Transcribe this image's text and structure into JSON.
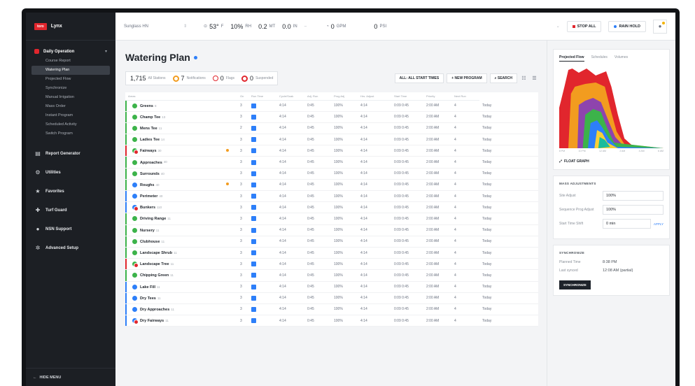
{
  "app": {
    "logo": "toro",
    "name": "Lynx"
  },
  "sidebar": {
    "group": {
      "label": "Daily Operation",
      "items": [
        {
          "label": "Course Report"
        },
        {
          "label": "Watering Plan",
          "active": true
        },
        {
          "label": "Projected Flow"
        },
        {
          "label": "Synchronize"
        },
        {
          "label": "Manual Irrigation"
        },
        {
          "label": "Mass Order"
        },
        {
          "label": "Instant Program"
        },
        {
          "label": "Scheduled Activity"
        },
        {
          "label": "Switch Program"
        }
      ]
    },
    "sections": [
      {
        "label": "Report Generator",
        "icon": "document-icon"
      },
      {
        "label": "Utilities",
        "icon": "utilities-icon"
      },
      {
        "label": "Favorites",
        "icon": "star-icon"
      },
      {
        "label": "Turf Guard",
        "icon": "sensor-icon"
      },
      {
        "label": "NSN Support",
        "icon": "support-icon"
      },
      {
        "label": "Advanced Setup",
        "icon": "gear-icon"
      }
    ],
    "hide_menu": "HIDE MENU"
  },
  "topbar": {
    "location": "Sunglass HN",
    "temp": "53°",
    "temp_unit": "F",
    "humidity": "10%",
    "humidity_unit": "RH",
    "wind": "0.2",
    "wind_unit": "MT",
    "rain": "0.0",
    "rain_unit": "IN",
    "flow": "0",
    "flow_unit": "GPM",
    "pressure": "0",
    "pressure_unit": "PSI",
    "stop_all": "STOP ALL",
    "rain_hold": "RAIN HOLD"
  },
  "plan": {
    "title": "Watering Plan",
    "stats": {
      "holes": "1,715",
      "holes_label": "All Stations",
      "notifications": "7",
      "notifications_label": "Notifications",
      "flags": "0",
      "flags_label": "Flags",
      "suspended": "0",
      "suspended_label": "Suspended"
    },
    "actions": {
      "all_start": "ALL: ALL START TIMES",
      "new_program": "+ NEW PROGRAM",
      "search": "SEARCH"
    },
    "columns": [
      "Areas",
      "",
      "On",
      "Run Time",
      "Cycle/Soak",
      "Adj. Run",
      "Prog Adj",
      "Hrs. Adjust",
      "Start Time",
      "Priority",
      "Next Run"
    ],
    "rows": [
      {
        "name": "Greens",
        "sub": "8",
        "icon": "g",
        "bar": "#3cb34a",
        "warn": false,
        "n": "3",
        "v1": "4:14",
        "v2": "0:45",
        "v3": "100%",
        "v4": "4:14",
        "v5": "0:09 0:45",
        "v6": "2:00 AM",
        "v7": "4",
        "v8": "Today"
      },
      {
        "name": "Champ Tee",
        "sub": "13",
        "icon": "g",
        "bar": "#3cb34a",
        "warn": false,
        "n": "3",
        "v1": "4:14",
        "v2": "0:45",
        "v3": "100%",
        "v4": "4:14",
        "v5": "0:09 0:45",
        "v6": "2:00 AM",
        "v7": "4",
        "v8": "Today"
      },
      {
        "name": "Mens Tee",
        "sub": "11",
        "icon": "g",
        "bar": "#3cb34a",
        "warn": false,
        "n": "2",
        "v1": "4:14",
        "v2": "0:45",
        "v3": "100%",
        "v4": "4:14",
        "v5": "0:09 0:45",
        "v6": "2:00 AM",
        "v7": "4",
        "v8": "Today"
      },
      {
        "name": "Ladies Tee",
        "sub": "14",
        "icon": "g",
        "bar": "#3cb34a",
        "warn": false,
        "n": "3",
        "v1": "4:14",
        "v2": "0:45",
        "v3": "100%",
        "v4": "4:14",
        "v5": "0:09 0:45",
        "v6": "2:00 AM",
        "v7": "4",
        "v8": "Today"
      },
      {
        "name": "Fairways",
        "sub": "30",
        "icon": "mix",
        "bar": "#e1262d",
        "warn": true,
        "n": "3",
        "v1": "4:14",
        "v2": "0:45",
        "v3": "100%",
        "v4": "4:14",
        "v5": "0:09 0:45",
        "v6": "2:00 AM",
        "v7": "4",
        "v8": "Today"
      },
      {
        "name": "Approaches",
        "sub": "40",
        "icon": "g",
        "bar": "#3cb34a",
        "warn": false,
        "n": "3",
        "v1": "4:14",
        "v2": "0:45",
        "v3": "100%",
        "v4": "4:14",
        "v5": "0:09 0:45",
        "v6": "2:00 AM",
        "v7": "4",
        "v8": "Today"
      },
      {
        "name": "Surrounds",
        "sub": "40",
        "icon": "g",
        "bar": "#3cb34a",
        "warn": false,
        "n": "3",
        "v1": "4:14",
        "v2": "0:45",
        "v3": "100%",
        "v4": "4:14",
        "v5": "0:09 0:45",
        "v6": "2:00 AM",
        "v7": "4",
        "v8": "Today"
      },
      {
        "name": "Roughs",
        "sub": "40",
        "icon": "b",
        "bar": "#3cb34a",
        "warn": true,
        "n": "3",
        "v1": "4:14",
        "v2": "0:45",
        "v3": "100%",
        "v4": "4:14",
        "v5": "0:09 0:45",
        "v6": "2:00 AM",
        "v7": "4",
        "v8": "Today"
      },
      {
        "name": "Perimeter",
        "sub": "40",
        "icon": "b",
        "bar": "#2d7ff9",
        "warn": false,
        "n": "3",
        "v1": "4:14",
        "v2": "0:45",
        "v3": "100%",
        "v4": "4:14",
        "v5": "0:09 0:45",
        "v6": "2:00 AM",
        "v7": "4",
        "v8": "Today"
      },
      {
        "name": "Bunkers",
        "sub": "110",
        "icon": "bmix",
        "bar": "#2d7ff9",
        "warn": false,
        "n": "3",
        "v1": "4:14",
        "v2": "0:45",
        "v3": "100%",
        "v4": "4:14",
        "v5": "0:09 0:45",
        "v6": "2:00 AM",
        "v7": "4",
        "v8": "Today"
      },
      {
        "name": "Driving Range",
        "sub": "11",
        "icon": "g",
        "bar": "#3cb34a",
        "warn": false,
        "n": "3",
        "v1": "4:14",
        "v2": "0:45",
        "v3": "100%",
        "v4": "4:14",
        "v5": "0:09 0:45",
        "v6": "2:00 AM",
        "v7": "4",
        "v8": "Today"
      },
      {
        "name": "Nursery",
        "sub": "11",
        "icon": "g",
        "bar": "#3cb34a",
        "warn": false,
        "n": "3",
        "v1": "4:14",
        "v2": "0:45",
        "v3": "100%",
        "v4": "4:14",
        "v5": "0:09 0:45",
        "v6": "2:00 AM",
        "v7": "4",
        "v8": "Today"
      },
      {
        "name": "Clubhouse",
        "sub": "11",
        "icon": "g",
        "bar": "#3cb34a",
        "warn": false,
        "n": "3",
        "v1": "4:14",
        "v2": "0:45",
        "v3": "100%",
        "v4": "4:14",
        "v5": "0:09 0:45",
        "v6": "2:00 AM",
        "v7": "4",
        "v8": "Today"
      },
      {
        "name": "Landscape Shrub",
        "sub": "11",
        "icon": "g",
        "bar": "#3cb34a",
        "warn": false,
        "n": "3",
        "v1": "4:14",
        "v2": "0:45",
        "v3": "100%",
        "v4": "4:14",
        "v5": "0:09 0:45",
        "v6": "2:00 AM",
        "v7": "4",
        "v8": "Today"
      },
      {
        "name": "Landscape Tree",
        "sub": "11",
        "icon": "mix",
        "bar": "#e1262d",
        "warn": false,
        "n": "3",
        "v1": "4:14",
        "v2": "0:45",
        "v3": "100%",
        "v4": "4:14",
        "v5": "0:09 0:45",
        "v6": "2:00 AM",
        "v7": "4",
        "v8": "Today"
      },
      {
        "name": "Chipping Green",
        "sub": "11",
        "icon": "g",
        "bar": "#3cb34a",
        "warn": false,
        "n": "3",
        "v1": "4:14",
        "v2": "0:45",
        "v3": "100%",
        "v4": "4:14",
        "v5": "0:09 0:45",
        "v6": "2:00 AM",
        "v7": "4",
        "v8": "Today"
      },
      {
        "name": "Lake Fill",
        "sub": "11",
        "icon": "b",
        "bar": "#2d7ff9",
        "warn": false,
        "n": "3",
        "v1": "4:14",
        "v2": "0:45",
        "v3": "100%",
        "v4": "4:14",
        "v5": "0:09 0:45",
        "v6": "2:00 AM",
        "v7": "4",
        "v8": "Today"
      },
      {
        "name": "Dry Tees",
        "sub": "11",
        "icon": "b",
        "bar": "#2d7ff9",
        "warn": false,
        "n": "3",
        "v1": "4:14",
        "v2": "0:45",
        "v3": "100%",
        "v4": "4:14",
        "v5": "0:09 0:45",
        "v6": "2:00 AM",
        "v7": "4",
        "v8": "Today"
      },
      {
        "name": "Dry Approaches",
        "sub": "11",
        "icon": "b",
        "bar": "#2d7ff9",
        "warn": false,
        "n": "3",
        "v1": "4:14",
        "v2": "0:45",
        "v3": "100%",
        "v4": "4:14",
        "v5": "0:09 0:45",
        "v6": "2:00 AM",
        "v7": "4",
        "v8": "Today"
      },
      {
        "name": "Dry Fairways",
        "sub": "11",
        "icon": "bmix",
        "bar": "#2d7ff9",
        "warn": false,
        "n": "3",
        "v1": "4:14",
        "v2": "0:45",
        "v3": "100%",
        "v4": "4:14",
        "v5": "0:09 0:45",
        "v6": "2:00 AM",
        "v7": "4",
        "v8": "Today"
      }
    ]
  },
  "right": {
    "tabs": [
      "Projected Flow",
      "Schedules",
      "Volumes"
    ],
    "chart_ticks": [
      "8 PM",
      "10 PM",
      "12 AM",
      "2 AM",
      "4 AM",
      "6 AM"
    ],
    "float_graph": "FLOAT GRAPH",
    "mass_adj": {
      "title": "MASS ADJUSTMENTS",
      "site_adjust_label": "Site Adjust",
      "site_adjust_value": "100%",
      "sequence_label": "Sequence Prog Adjust",
      "sequence_value": "100%",
      "start_shift_label": "Start Time Shift",
      "start_shift_value": "0 min",
      "start_shift_link": "APPLY"
    },
    "sync": {
      "title": "SYNCHRONIZE",
      "planned_label": "Planned Time",
      "planned_value": "8:38 PM",
      "last_label": "Last synced",
      "last_value": "12:08 AM (partial)",
      "button": "SYNCHRONIZE"
    }
  },
  "colors": {
    "accent": "#2d7ff9",
    "brand_red": "#e1262d",
    "green": "#3cb34a",
    "warn": "#f29c1f"
  }
}
